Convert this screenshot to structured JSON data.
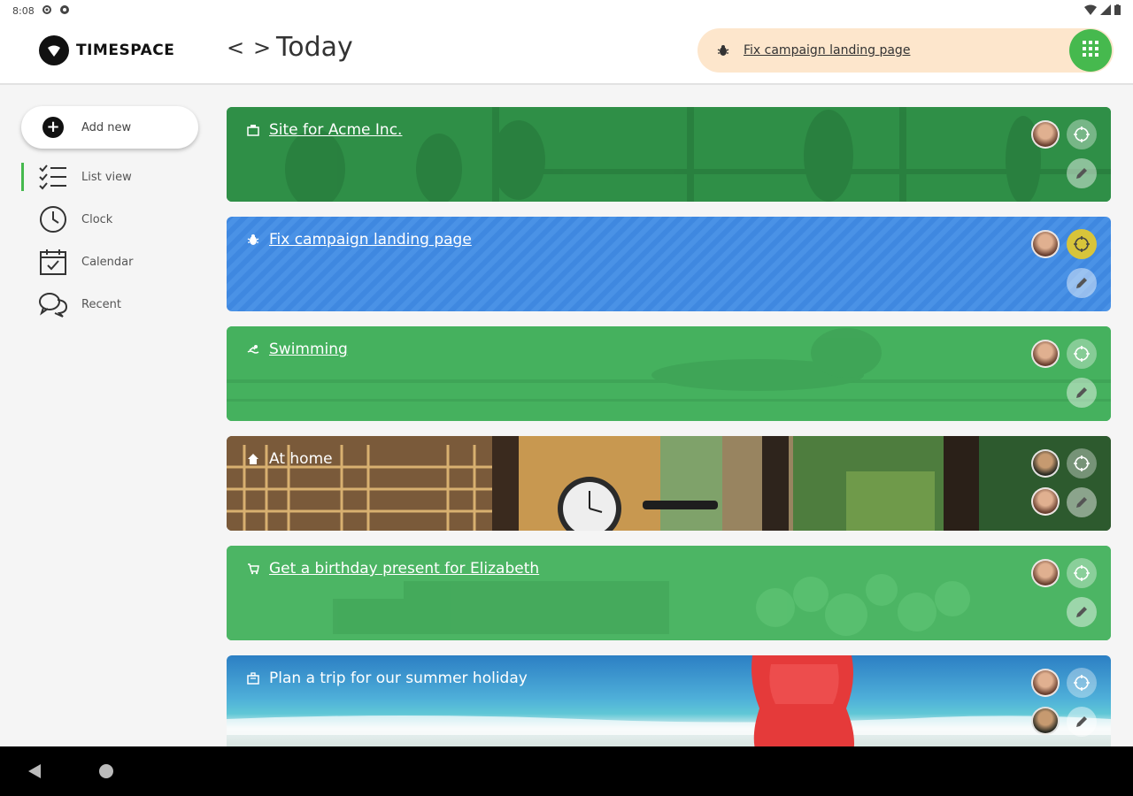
{
  "status_bar": {
    "time": "8:08"
  },
  "app": {
    "name": "TIMESPACE"
  },
  "header": {
    "title": "Today",
    "prev_label": "<",
    "next_label": ">"
  },
  "active_task": {
    "label": "Fix campaign landing page",
    "icon": "bug-icon"
  },
  "sidebar": {
    "add_new": "Add new",
    "items": [
      {
        "label": "List view",
        "icon": "list-icon",
        "active": true
      },
      {
        "label": "Clock",
        "icon": "clock-icon",
        "active": false
      },
      {
        "label": "Calendar",
        "icon": "calendar-icon",
        "active": false
      },
      {
        "label": "Recent",
        "icon": "chat-bubbles-icon",
        "active": false
      }
    ]
  },
  "cards": [
    {
      "title": "Site for Acme Inc.",
      "icon": "building-icon",
      "background": "#2f8f47"
    },
    {
      "title": "Fix campaign landing page",
      "icon": "bug-icon",
      "background": "#3f88e0",
      "focus_active": true
    },
    {
      "title": "Swimming",
      "icon": "swimmer-icon",
      "background": "#45b15e"
    },
    {
      "title": "At home",
      "icon": "house-icon",
      "background": "photo"
    },
    {
      "title": "Get a birthday present for Elizabeth",
      "icon": "cart-icon",
      "background": "#45b15e"
    },
    {
      "title": "Plan a trip for our summer holiday",
      "icon": "luggage-icon",
      "background": "photo"
    }
  ],
  "colors": {
    "accent": "#46b94e",
    "active_pill": "#fde6cc",
    "focus_active": "#d8c43a"
  }
}
